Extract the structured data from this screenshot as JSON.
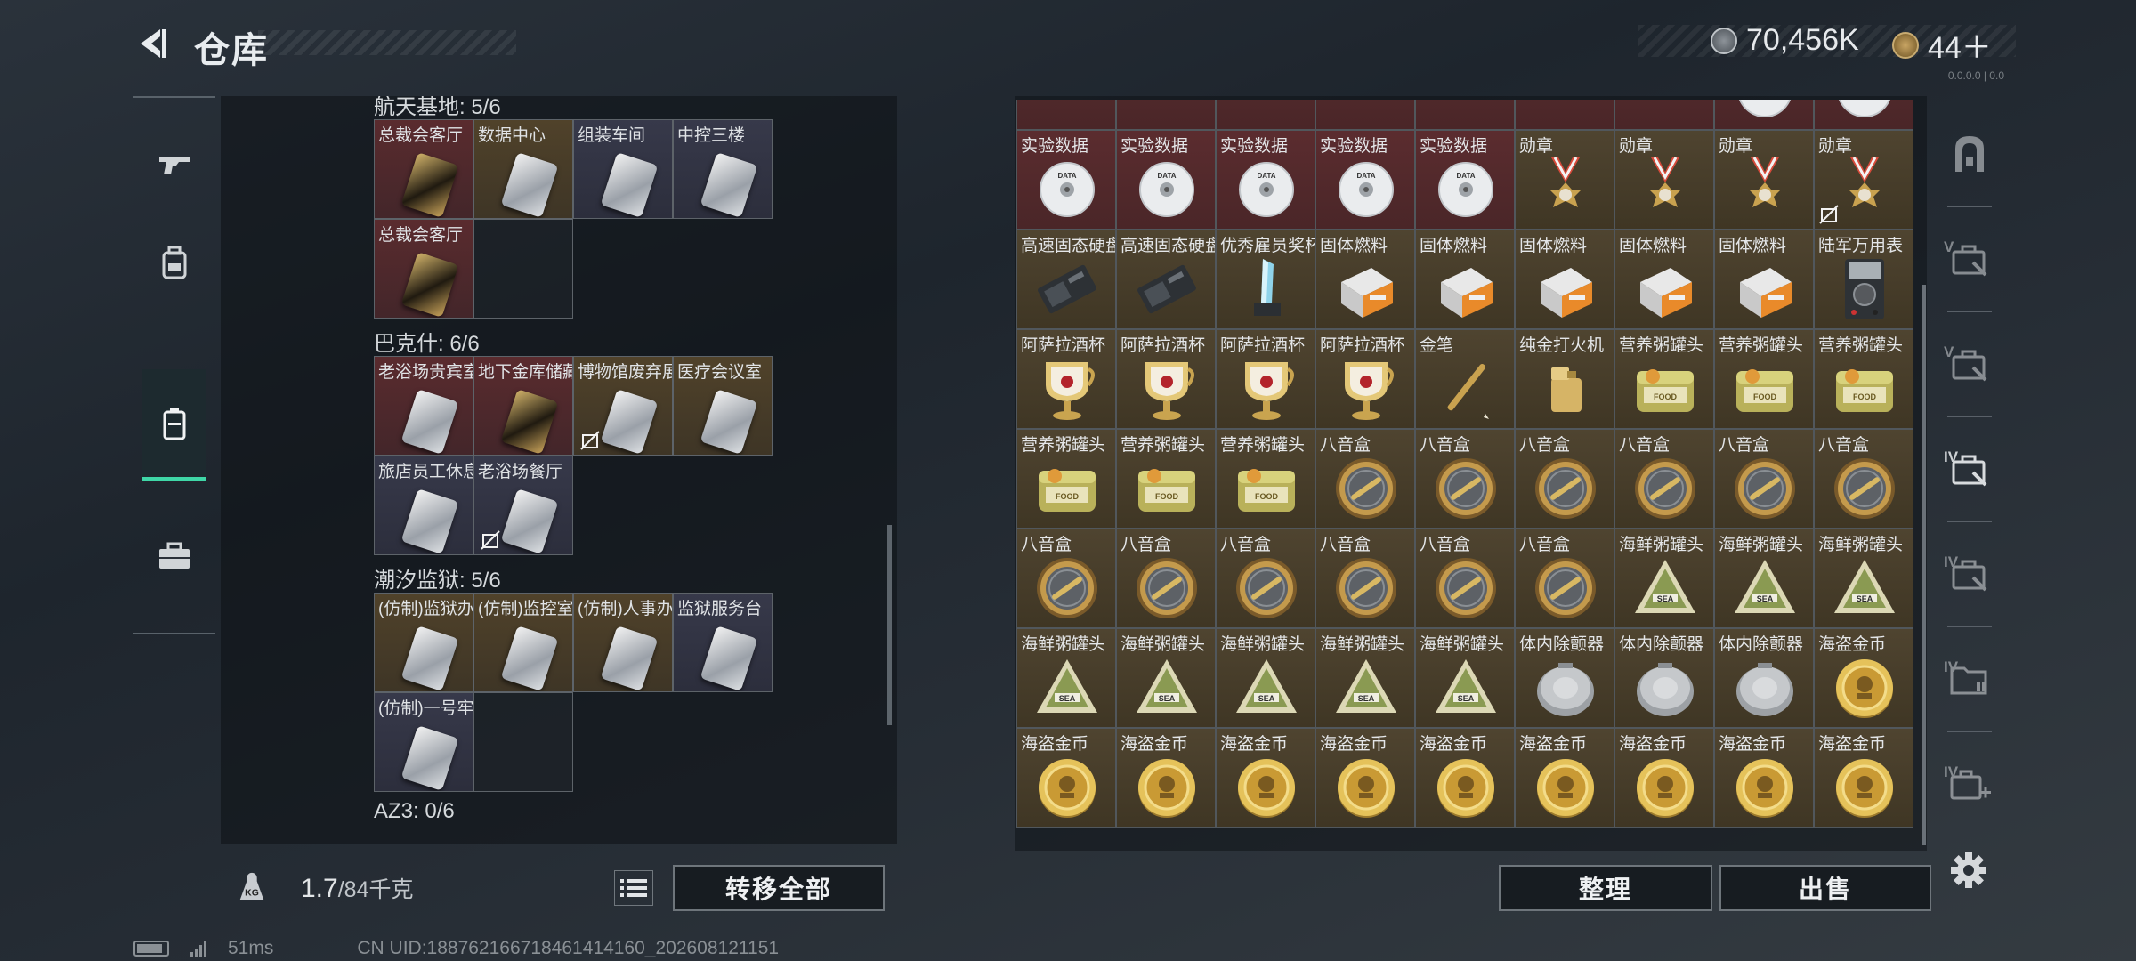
{
  "header": {
    "title": "仓库",
    "currency": {
      "coins": "70,456K",
      "tickets": "44＋"
    },
    "tag": "0.0.0.0 | 0.0"
  },
  "left_nav": [
    {
      "name": "weapons",
      "icon": "pistol-icon"
    },
    {
      "name": "gear",
      "icon": "backpack-icon"
    },
    {
      "name": "keys",
      "icon": "keycard-case-icon",
      "active": true
    },
    {
      "name": "toolbox",
      "icon": "briefcase-icon"
    }
  ],
  "left_panel": {
    "sections": [
      {
        "title": "航天基地: 5/6",
        "cells": [
          {
            "label": "总裁会客厅",
            "bg": "red",
            "card": "gold"
          },
          {
            "label": "数据中心",
            "bg": "gold",
            "card": "silver"
          },
          {
            "label": "组装车间",
            "bg": "blue",
            "card": "silver"
          },
          {
            "label": "中控三楼",
            "bg": "blue",
            "card": "silver"
          },
          {
            "label": "总裁会客厅",
            "bg": "red",
            "card": "gold"
          },
          {
            "label": "",
            "bg": "empty",
            "card": ""
          }
        ]
      },
      {
        "title": "巴克什: 6/6",
        "cells": [
          {
            "label": "老浴场贵宾室",
            "bg": "red",
            "card": "silver"
          },
          {
            "label": "地下金库储藏间",
            "bg": "red",
            "card": "gold"
          },
          {
            "label": "博物馆废弃展厅",
            "bg": "gold",
            "card": "silver",
            "locked": true
          },
          {
            "label": "医疗会议室",
            "bg": "gold",
            "card": "silver"
          },
          {
            "label": "旅店员工休息室",
            "bg": "blue",
            "card": "silver"
          },
          {
            "label": "老浴场餐厅",
            "bg": "blue",
            "card": "silver",
            "locked": true
          }
        ]
      },
      {
        "title": "潮汐监狱: 5/6",
        "cells": [
          {
            "label": "(仿制)监狱办公室",
            "bg": "gold",
            "card": "silver"
          },
          {
            "label": "(仿制)监控室",
            "bg": "gold",
            "card": "silver"
          },
          {
            "label": "(仿制)人事办公室",
            "bg": "gold",
            "card": "silver"
          },
          {
            "label": "监狱服务台",
            "bg": "blue",
            "card": "silver"
          },
          {
            "label": "(仿制)一号牢房",
            "bg": "blue",
            "card": "silver"
          },
          {
            "label": "",
            "bg": "empty",
            "card": ""
          }
        ]
      },
      {
        "title": "AZ3: 0/6",
        "cells": []
      }
    ],
    "weight": {
      "current": "1.7",
      "max": "/84千克"
    },
    "move_all": "转移全部"
  },
  "right_panel": {
    "items": [
      {
        "label": "",
        "icon": "trophy",
        "bg": "red"
      },
      {
        "label": "",
        "icon": "canister",
        "bg": "red"
      },
      {
        "label": "",
        "icon": "canister",
        "bg": "red"
      },
      {
        "label": "",
        "icon": "usb",
        "bg": "red"
      },
      {
        "label": "",
        "icon": "usb",
        "bg": "red"
      },
      {
        "label": "",
        "icon": "usb",
        "bg": "red"
      },
      {
        "label": "",
        "icon": "usb",
        "bg": "red"
      },
      {
        "label": "",
        "icon": "disc",
        "bg": "red"
      },
      {
        "label": "",
        "icon": "disc",
        "bg": "red"
      },
      {
        "label": "实验数据",
        "icon": "disc",
        "bg": "red"
      },
      {
        "label": "实验数据",
        "icon": "disc",
        "bg": "red"
      },
      {
        "label": "实验数据",
        "icon": "disc",
        "bg": "red"
      },
      {
        "label": "实验数据",
        "icon": "disc",
        "bg": "red"
      },
      {
        "label": "实验数据",
        "icon": "disc",
        "bg": "red"
      },
      {
        "label": "勋章",
        "icon": "medal",
        "bg": "gold"
      },
      {
        "label": "勋章",
        "icon": "medal",
        "bg": "gold"
      },
      {
        "label": "勋章",
        "icon": "medal",
        "bg": "gold"
      },
      {
        "label": "勋章",
        "icon": "medal",
        "bg": "gold",
        "locked": true
      },
      {
        "label": "高速固态硬盘",
        "icon": "ssd",
        "bg": "gold"
      },
      {
        "label": "高速固态硬盘",
        "icon": "ssd",
        "bg": "gold"
      },
      {
        "label": "优秀雇员奖杯",
        "icon": "crystal",
        "bg": "gold"
      },
      {
        "label": "固体燃料",
        "icon": "fuel",
        "bg": "gold"
      },
      {
        "label": "固体燃料",
        "icon": "fuel",
        "bg": "gold"
      },
      {
        "label": "固体燃料",
        "icon": "fuel",
        "bg": "gold"
      },
      {
        "label": "固体燃料",
        "icon": "fuel",
        "bg": "gold"
      },
      {
        "label": "固体燃料",
        "icon": "fuel",
        "bg": "gold"
      },
      {
        "label": "陆军万用表",
        "icon": "multimeter",
        "bg": "gold"
      },
      {
        "label": "阿萨拉酒杯",
        "icon": "goblet",
        "bg": "gold"
      },
      {
        "label": "阿萨拉酒杯",
        "icon": "goblet",
        "bg": "gold"
      },
      {
        "label": "阿萨拉酒杯",
        "icon": "goblet",
        "bg": "gold"
      },
      {
        "label": "阿萨拉酒杯",
        "icon": "goblet",
        "bg": "gold"
      },
      {
        "label": "金笔",
        "icon": "pen",
        "bg": "gold"
      },
      {
        "label": "纯金打火机",
        "icon": "lighter",
        "bg": "gold"
      },
      {
        "label": "营养粥罐头",
        "icon": "tin",
        "bg": "gold"
      },
      {
        "label": "营养粥罐头",
        "icon": "tin",
        "bg": "gold"
      },
      {
        "label": "营养粥罐头",
        "icon": "tin",
        "bg": "gold"
      },
      {
        "label": "营养粥罐头",
        "icon": "tin",
        "bg": "gold"
      },
      {
        "label": "营养粥罐头",
        "icon": "tin",
        "bg": "gold"
      },
      {
        "label": "营养粥罐头",
        "icon": "tin",
        "bg": "gold"
      },
      {
        "label": "八音盒",
        "icon": "musicbox",
        "bg": "gold"
      },
      {
        "label": "八音盒",
        "icon": "musicbox",
        "bg": "gold"
      },
      {
        "label": "八音盒",
        "icon": "musicbox",
        "bg": "gold"
      },
      {
        "label": "八音盒",
        "icon": "musicbox",
        "bg": "gold"
      },
      {
        "label": "八音盒",
        "icon": "musicbox",
        "bg": "gold"
      },
      {
        "label": "八音盒",
        "icon": "musicbox",
        "bg": "gold"
      },
      {
        "label": "八音盒",
        "icon": "musicbox",
        "bg": "gold"
      },
      {
        "label": "八音盒",
        "icon": "musicbox",
        "bg": "gold"
      },
      {
        "label": "八音盒",
        "icon": "musicbox",
        "bg": "gold"
      },
      {
        "label": "八音盒",
        "icon": "musicbox",
        "bg": "gold"
      },
      {
        "label": "八音盒",
        "icon": "musicbox",
        "bg": "gold"
      },
      {
        "label": "八音盒",
        "icon": "musicbox",
        "bg": "gold"
      },
      {
        "label": "海鲜粥罐头",
        "icon": "seafood",
        "bg": "gold"
      },
      {
        "label": "海鲜粥罐头",
        "icon": "seafood",
        "bg": "gold"
      },
      {
        "label": "海鲜粥罐头",
        "icon": "seafood",
        "bg": "gold"
      },
      {
        "label": "海鲜粥罐头",
        "icon": "seafood",
        "bg": "gold"
      },
      {
        "label": "海鲜粥罐头",
        "icon": "seafood",
        "bg": "gold"
      },
      {
        "label": "海鲜粥罐头",
        "icon": "seafood",
        "bg": "gold"
      },
      {
        "label": "海鲜粥罐头",
        "icon": "seafood",
        "bg": "gold"
      },
      {
        "label": "海鲜粥罐头",
        "icon": "seafood",
        "bg": "gold"
      },
      {
        "label": "体内除颤器",
        "icon": "defib",
        "bg": "gold"
      },
      {
        "label": "体内除颤器",
        "icon": "defib",
        "bg": "gold"
      },
      {
        "label": "体内除颤器",
        "icon": "defib",
        "bg": "gold"
      },
      {
        "label": "海盗金币",
        "icon": "coin",
        "bg": "gold"
      },
      {
        "label": "海盗金币",
        "icon": "coin",
        "bg": "gold"
      },
      {
        "label": "海盗金币",
        "icon": "coin",
        "bg": "gold"
      },
      {
        "label": "海盗金币",
        "icon": "coin",
        "bg": "gold"
      },
      {
        "label": "海盗金币",
        "icon": "coin",
        "bg": "gold"
      },
      {
        "label": "海盗金币",
        "icon": "coin",
        "bg": "gold"
      },
      {
        "label": "海盗金币",
        "icon": "coin",
        "bg": "gold"
      },
      {
        "label": "海盗金币",
        "icon": "coin",
        "bg": "gold"
      },
      {
        "label": "海盗金币",
        "icon": "coin",
        "bg": "gold"
      },
      {
        "label": "海盗金币",
        "icon": "coin",
        "bg": "gold"
      }
    ],
    "sort": "整理",
    "sell": "出售"
  },
  "right_nav": [
    {
      "name": "vault",
      "icon": "safe-icon",
      "tier": ""
    },
    {
      "name": "case-5",
      "icon": "case-icon",
      "tier": "V"
    },
    {
      "name": "case-4",
      "icon": "case-icon",
      "tier": "V"
    },
    {
      "name": "case-3",
      "icon": "case-icon",
      "tier": "IV",
      "active": true
    },
    {
      "name": "case-2",
      "icon": "case-icon",
      "tier": "IV"
    },
    {
      "name": "folder-1",
      "icon": "folder-icon",
      "tier": "IV"
    },
    {
      "name": "add-case",
      "icon": "add-case-icon",
      "tier": "IV"
    }
  ],
  "status": {
    "ping": "51ms",
    "uid": "CN UID:188762166718461414160_202608121151"
  }
}
